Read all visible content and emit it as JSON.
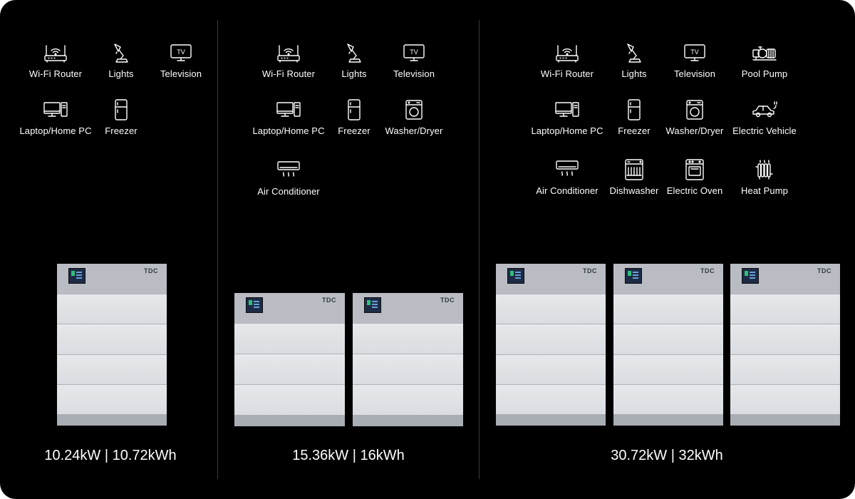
{
  "sections": [
    {
      "title": "10.24kW | 10.72kWh",
      "appliances": [
        {
          "label": "Wi-Fi Router",
          "icon": "router-icon"
        },
        {
          "label": "Lights",
          "icon": "lamp-icon"
        },
        {
          "label": "Television",
          "icon": "tv-icon"
        },
        {
          "label": "Laptop/Home PC",
          "icon": "computer-icon"
        },
        {
          "label": "Freezer",
          "icon": "fridge-icon"
        }
      ],
      "battery_count": 1
    },
    {
      "title": "15.36kW | 16kWh",
      "appliances": [
        {
          "label": "Wi-Fi Router",
          "icon": "router-icon"
        },
        {
          "label": "Lights",
          "icon": "lamp-icon"
        },
        {
          "label": "Television",
          "icon": "tv-icon"
        },
        {
          "label": "Laptop/Home PC",
          "icon": "computer-icon"
        },
        {
          "label": "Freezer",
          "icon": "fridge-icon"
        },
        {
          "label": "Washer/Dryer",
          "icon": "washer-icon"
        },
        {
          "label": "Air Conditioner",
          "icon": "air-conditioner-icon"
        }
      ],
      "battery_count": 2
    },
    {
      "title": "30.72kW | 32kWh",
      "appliances": [
        {
          "label": "Wi-Fi Router",
          "icon": "router-icon"
        },
        {
          "label": "Lights",
          "icon": "lamp-icon"
        },
        {
          "label": "Television",
          "icon": "tv-icon"
        },
        {
          "label": "Pool Pump",
          "icon": "pump-icon"
        },
        {
          "label": "Laptop/Home PC",
          "icon": "computer-icon"
        },
        {
          "label": "Freezer",
          "icon": "fridge-icon"
        },
        {
          "label": "Washer/Dryer",
          "icon": "washer-icon"
        },
        {
          "label": "Electric Vehicle",
          "icon": "car-icon"
        },
        {
          "label": "Air Conditioner",
          "icon": "air-conditioner-icon"
        },
        {
          "label": "Dishwasher",
          "icon": "dishwasher-icon"
        },
        {
          "label": "Electric Oven",
          "icon": "oven-icon"
        },
        {
          "label": "Heat Pump",
          "icon": "radiator-icon"
        }
      ],
      "battery_count": 3
    }
  ],
  "battery": {
    "brand": "TDC"
  },
  "tv_icon_text": "TV",
  "colors": {
    "background": "#000000",
    "text": "#ffffff",
    "divider": "#3a3a3a",
    "battery_body": "#d9dce0",
    "battery_header": "#b9bcc3"
  }
}
